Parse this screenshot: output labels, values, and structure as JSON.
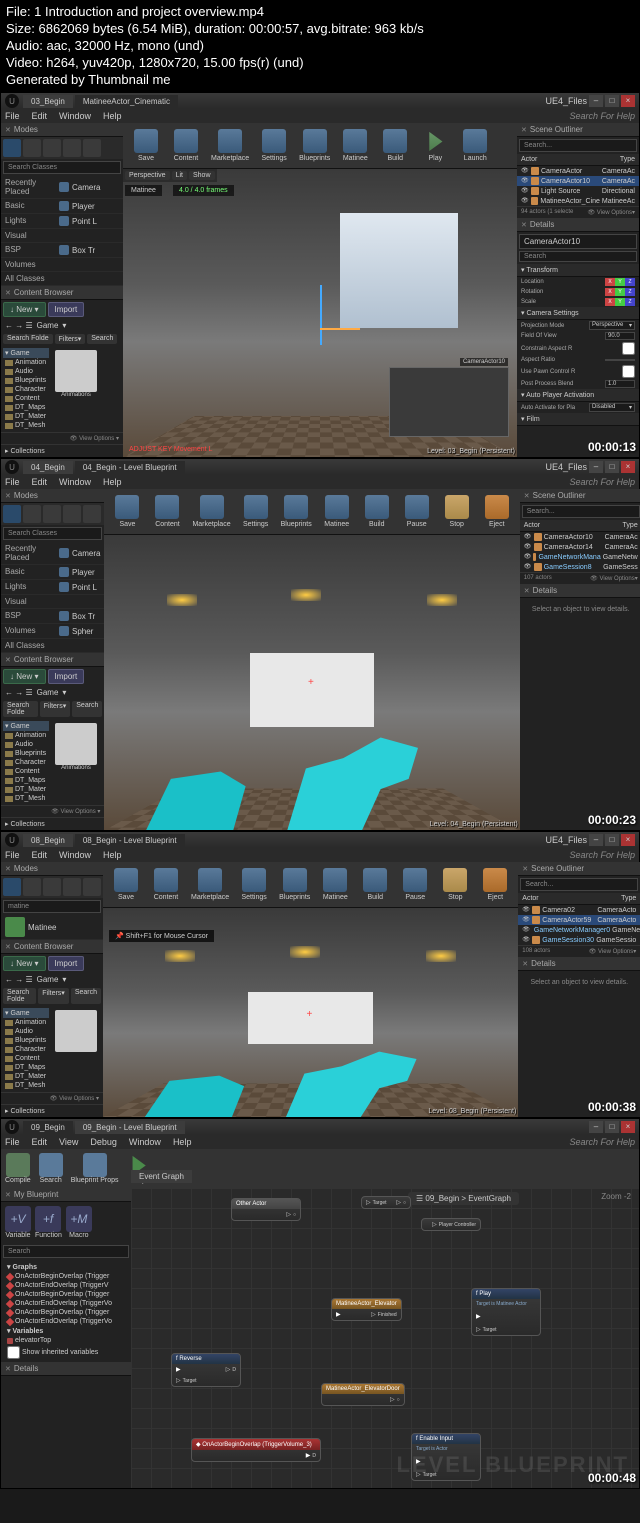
{
  "header": {
    "file": "File: 1 Introduction and project overview.mp4",
    "size": "Size: 6862069 bytes (6.54 MiB), duration: 00:00:57, avg.bitrate: 963 kb/s",
    "audio": "Audio: aac, 32000 Hz, mono (und)",
    "video": "Video: h264, yuv420p, 1280x720, 15.00 fps(r) (und)",
    "generated": "Generated by Thumbnail me"
  },
  "screenshots": [
    {
      "timestamp": "00:00:13",
      "tabs": [
        "03_Begin",
        "MatineeActor_Cinematic"
      ],
      "project": "UE4_Files",
      "menu": [
        "File",
        "Edit",
        "Window",
        "Help"
      ],
      "search_help": "Search For Help",
      "toolbar": [
        "Save",
        "Content",
        "Marketplace",
        "Settings",
        "Blueprints",
        "Matinee",
        "Build",
        "Play",
        "Launch"
      ],
      "vp_tools": [
        "Perspective",
        "Lit",
        "Show"
      ],
      "vp_frames": "4.0 / 4.0 frames",
      "vp_label": "Matinee",
      "vp_adjust": "ADJUST KEY Movement L",
      "vp_adjust2": "ADJUST KEY Movement L",
      "vp_camera": "CameraActor10",
      "level": "Level: 03_Begin (Persistent)",
      "modes": {
        "title": "Modes",
        "search": "Search Classes",
        "cats": [
          "Recently Placed",
          "Basic",
          "Lights",
          "Visual",
          "BSP",
          "Volumes",
          "All Classes"
        ],
        "items": [
          "Camera",
          "Player",
          "Point L",
          "Box Tr"
        ]
      },
      "cb": {
        "title": "Content Browser",
        "new": "New",
        "import": "Import",
        "path": "Game",
        "search": "Search Folde",
        "filters": "Filters",
        "filter_search": "Search",
        "root": "Game",
        "folders": [
          "Animation",
          "Audio",
          "Blueprints",
          "Character",
          "Content",
          "DT_Maps",
          "DT_Mater",
          "DT_Mesh"
        ],
        "thumb": "Animations",
        "collections": "Collections",
        "view": "View Options"
      },
      "outliner": {
        "title": "Scene Outliner",
        "search": "Search...",
        "head": [
          "Actor",
          "Type"
        ],
        "rows": [
          {
            "name": "CameraActor",
            "type": "CameraAc"
          },
          {
            "name": "CameraActor10",
            "type": "CameraAc",
            "sel": true
          },
          {
            "name": "Light Source",
            "type": "Directional"
          },
          {
            "name": "MatineeActor_Cine",
            "type": "MatineeAc"
          }
        ],
        "footer": "94 actors (1 selecte",
        "view": "View Options"
      },
      "details": {
        "title": "Details",
        "name": "CameraActor10",
        "search": "Search",
        "transform": {
          "title": "Transform",
          "rows": [
            "Location",
            "Rotation",
            "Scale"
          ]
        },
        "camera": {
          "title": "Camera Settings",
          "projection": {
            "label": "Projection Mode",
            "val": "Perspective"
          },
          "fov": {
            "label": "Field Of View",
            "val": "90.0"
          },
          "constrain": {
            "label": "Constrain Aspect R"
          },
          "aspect": {
            "label": "Aspect Ratio"
          },
          "pawn": {
            "label": "Use Pawn Control R"
          },
          "post": {
            "label": "Post Process Blend",
            "val": "1.0"
          }
        },
        "autoplayer": {
          "title": "Auto Player Activation",
          "activate": {
            "label": "Auto Activate for Pla",
            "val": "Disabled"
          }
        },
        "film": {
          "title": "Film"
        }
      }
    },
    {
      "timestamp": "00:00:23",
      "tabs": [
        "04_Begin",
        "04_Begin - Level Blueprint"
      ],
      "project": "UE4_Files",
      "menu": [
        "File",
        "Edit",
        "Window",
        "Help"
      ],
      "search_help": "Search For Help",
      "toolbar": [
        "Save",
        "Content",
        "Marketplace",
        "Settings",
        "Blueprints",
        "Matinee",
        "Build",
        "Pause",
        "Stop",
        "Eject"
      ],
      "level": "Level: 04_Begin (Persistent)",
      "modes": {
        "title": "Modes",
        "search": "Search Classes",
        "cats": [
          "Recently Placed",
          "Basic",
          "Lights",
          "Visual",
          "BSP",
          "Volumes",
          "All Classes"
        ],
        "items": [
          "Camera",
          "Player",
          "Point L",
          "Box Tr",
          "Spher"
        ]
      },
      "cb": {
        "title": "Content Browser",
        "new": "New",
        "import": "Import",
        "path": "Game",
        "search": "Search Folde",
        "filters": "Filters",
        "filter_search": "Search",
        "root": "Game",
        "folders": [
          "Animation",
          "Audio",
          "Blueprints",
          "Character",
          "Content",
          "DT_Maps",
          "DT_Mater",
          "DT_Mesh"
        ],
        "thumb": "Animations",
        "collections": "Collections",
        "view": "View Options"
      },
      "outliner": {
        "title": "Scene Outliner",
        "search": "Search...",
        "head": [
          "Actor",
          "Type"
        ],
        "rows": [
          {
            "name": "CameraActor10",
            "type": "CameraAc"
          },
          {
            "name": "CameraActor14",
            "type": "CameraAc"
          },
          {
            "name": "GameNetworkMana",
            "type": "GameNetw"
          },
          {
            "name": "GameSession8",
            "type": "GameSess"
          }
        ],
        "footer": "107 actors",
        "view": "View Options"
      },
      "details": {
        "title": "Details",
        "msg": "Select an object to view details."
      }
    },
    {
      "timestamp": "00:00:38",
      "tabs": [
        "08_Begin",
        "08_Begin - Level Blueprint"
      ],
      "project": "UE4_Files",
      "menu": [
        "File",
        "Edit",
        "Window",
        "Help"
      ],
      "search_help": "Search For Help",
      "toolbar": [
        "Save",
        "Content",
        "Marketplace",
        "Settings",
        "Blueprints",
        "Matinee",
        "Build",
        "Pause",
        "Stop",
        "Eject"
      ],
      "hint": "Shift+F1 for Mouse Cursor",
      "level": "Level: 08_Begin (Persistent)",
      "modes": {
        "title": "Modes",
        "search": "matine",
        "item": "Matinee"
      },
      "cb": {
        "title": "Content Browser",
        "new": "New",
        "import": "Import",
        "path": "Game",
        "search": "Search Folde",
        "filters": "Filters",
        "filter_search": "Search",
        "root": "Game",
        "folders": [
          "Animation",
          "Audio",
          "Blueprints",
          "Character",
          "Content",
          "DT_Maps",
          "DT_Mater",
          "DT_Mesh"
        ],
        "collections": "Collections",
        "view": "View Options"
      },
      "outliner": {
        "title": "Scene Outliner",
        "search": "Search...",
        "head": [
          "Actor",
          "Type"
        ],
        "rows": [
          {
            "name": "Camera02",
            "type": "CameraActo"
          },
          {
            "name": "CameraActor59",
            "type": "CameraActo",
            "sel": true
          },
          {
            "name": "GameNetworkManager0",
            "type": "GameNetwo"
          },
          {
            "name": "GameSession30",
            "type": "GameSessio"
          }
        ],
        "footer": "108 actors",
        "view": "View Options"
      },
      "details": {
        "title": "Details",
        "msg": "Select an object to view details."
      }
    },
    {
      "timestamp": "00:00:48",
      "tabs": [
        "09_Begin",
        "09_Begin - Level Blueprint"
      ],
      "menu": [
        "File",
        "Edit",
        "View",
        "Debug",
        "Window",
        "Help"
      ],
      "search_help": "Search For Help",
      "toolbar": [
        "Compile",
        "Search",
        "Blueprint Props",
        "Play"
      ],
      "mybp": {
        "title": "My Blueprint",
        "vars": [
          "Variable",
          "Function",
          "Macro"
        ],
        "search": "Search",
        "graphs_title": "Graphs",
        "graphs": [
          "OnActorBeginOverlap (Trigger",
          "OnActorEndOverlap (TriggerV",
          "OnActorBeginOverlap (Trigger",
          "OnActorEndOverlap (TriggerVo",
          "OnActorBeginOverlap (Trigger",
          "OnActorEndOverlap (TriggerVo"
        ],
        "vars_title": "Variables",
        "var_rows": [
          "elevatorTop"
        ],
        "show_inherited": "Show inherited variables"
      },
      "details_title": "Details",
      "graph": {
        "tab": "Event Graph",
        "breadcrumb": "09_Begin > EventGraph",
        "zoom": "Zoom -2",
        "watermark": "LEVEL BLUEPRINT",
        "nodes": {
          "other_actor": "Other Actor",
          "target": "Target",
          "player_controller": "Player Controller",
          "matinee_elevator": "MatineeActor_Elevator",
          "finished": "Finished",
          "play": "Play",
          "play_target": "Target is Matinee Actor",
          "target_pin": "Target",
          "reverse": "Reverse",
          "matinee_door": "MatineeActor_ElevatorDoor",
          "on_overlap": "OnActorBeginOverlap (TriggerVolume_3)",
          "enable_input": "Enable Input",
          "target_self": "Target is Actor"
        }
      }
    }
  ]
}
